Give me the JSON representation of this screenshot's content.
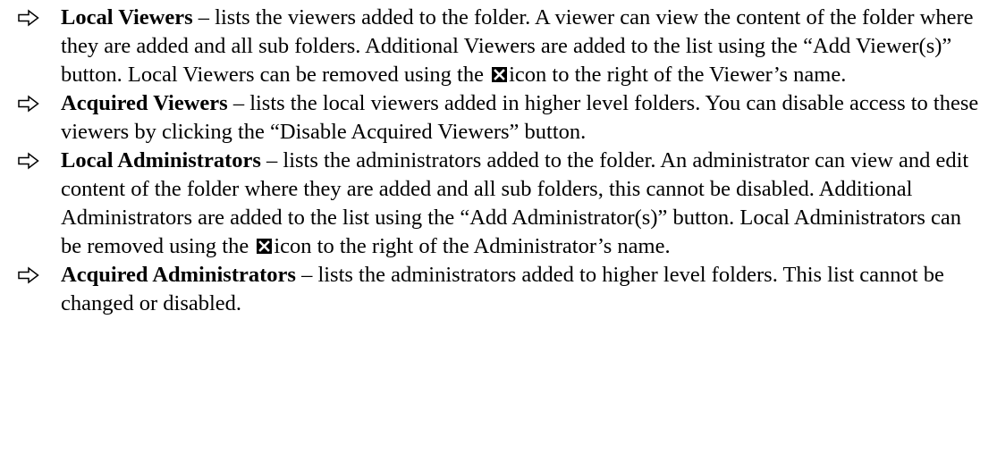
{
  "items": [
    {
      "icon": "right-arrow-icon",
      "term": "Local Viewers",
      "text_before_icon": " – lists the viewers added to the folder. A viewer can view the content of the folder where they are added and all sub folders. Additional Viewers are added to the list using the “Add Viewer(s)” button. Local Viewers can be removed using the ",
      "inline_icon": "remove-icon",
      "text_after_icon": "icon to the right of the Viewer’s name."
    },
    {
      "icon": "right-arrow-icon",
      "term": "Acquired Viewers",
      "text": " – lists the local viewers added in higher level folders. You can disable access to these viewers by clicking the “Disable Acquired Viewers” button."
    },
    {
      "icon": "right-arrow-icon",
      "term": "Local Administrators",
      "text_before_icon": " – lists the administrators added to the folder. An administrator can view and edit content of the folder where they are added and all sub folders, this cannot be disabled. Additional Administrators are added to the list using the “Add Administrator(s)” button. Local Administrators can be removed using the ",
      "inline_icon": "remove-icon",
      "text_after_icon": "icon to the right of the Administrator’s name."
    },
    {
      "icon": "right-arrow-icon",
      "term": "Acquired Administrators",
      "text": " – lists the administrators added to higher level folders. This list cannot be changed or disabled."
    }
  ],
  "colors": {
    "text": "#000000",
    "background": "#ffffff",
    "icon_fill": "#000000"
  }
}
